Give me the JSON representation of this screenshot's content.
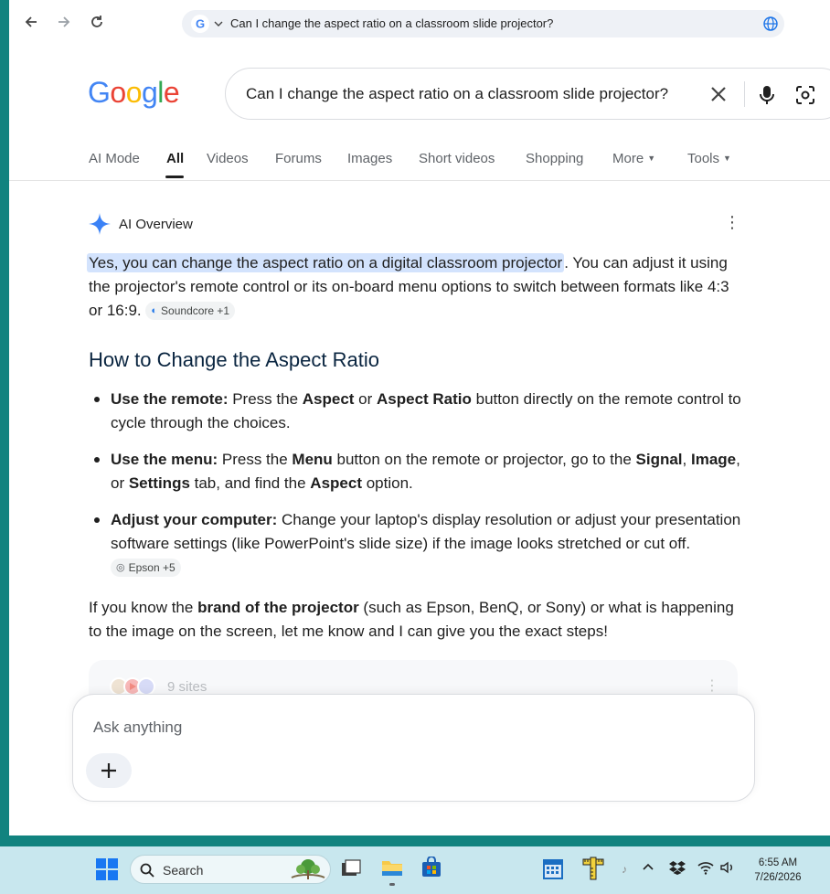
{
  "browser": {
    "back_icon": "arrow-left-icon",
    "forward_icon": "arrow-right-icon",
    "reload_icon": "reload-icon",
    "address": "Can I change the aspect ratio on a classroom slide projector?"
  },
  "google": {
    "logo_text": "Google",
    "query": "Can I change the aspect ratio on a classroom slide projector?",
    "tabs": [
      "AI Mode",
      "All",
      "Videos",
      "Forums",
      "Images",
      "Short videos",
      "Shopping",
      "More",
      "Tools"
    ],
    "active_tab": "All"
  },
  "ai_overview": {
    "title": "AI Overview",
    "intro_highlight": "Yes, you can change the aspect ratio on a digital classroom projector",
    "intro_rest": ". You can adjust it using the projector's remote control or its on-board menu options to switch between formats like 4:3 or 16:9.",
    "intro_chip": "Soundcore +1",
    "heading": "How to Change the Aspect Ratio",
    "bullets": [
      {
        "lead": "Use the remote:",
        "t1": " Press the ",
        "b1": "Aspect",
        "t2": " or ",
        "b2": "Aspect Ratio",
        "t3": " button directly on the remote control to cycle through the choices."
      },
      {
        "lead": "Use the menu:",
        "t1": " Press the ",
        "b1": "Menu",
        "t2": " button on the remote or projector, go to the ",
        "b2": "Signal",
        "t3": ", ",
        "b3": "Image",
        "t4": ", or ",
        "b4": "Settings",
        "t5": " tab, and find the ",
        "b5": "Aspect",
        "t6": " option."
      },
      {
        "lead": "Adjust your computer:",
        "t1": " Change your laptop's display resolution or adjust your presentation software settings (like PowerPoint's slide size) if the image looks stretched or cut off.",
        "chip": "Epson +5"
      }
    ],
    "closing_t1": "If you know the ",
    "closing_b1": "brand of the projector",
    "closing_t2": " (such as Epson, BenQ, or Sony) or what is happening to the image on the screen, let me know and I can give you the exact steps!",
    "sites_label": "9 sites"
  },
  "ask": {
    "placeholder": "Ask anything",
    "plus_label": "+"
  },
  "taskbar": {
    "search_label": "Search",
    "time": "6:55 AM",
    "date": "7/26/2026"
  },
  "colors": {
    "google_blue": "#4285f4",
    "google_red": "#ea4335",
    "google_yellow": "#fbbc05",
    "google_green": "#34a853",
    "highlight": "#d3e3fd",
    "desktop": "#11837f",
    "taskbar": "#c8e7ee"
  }
}
